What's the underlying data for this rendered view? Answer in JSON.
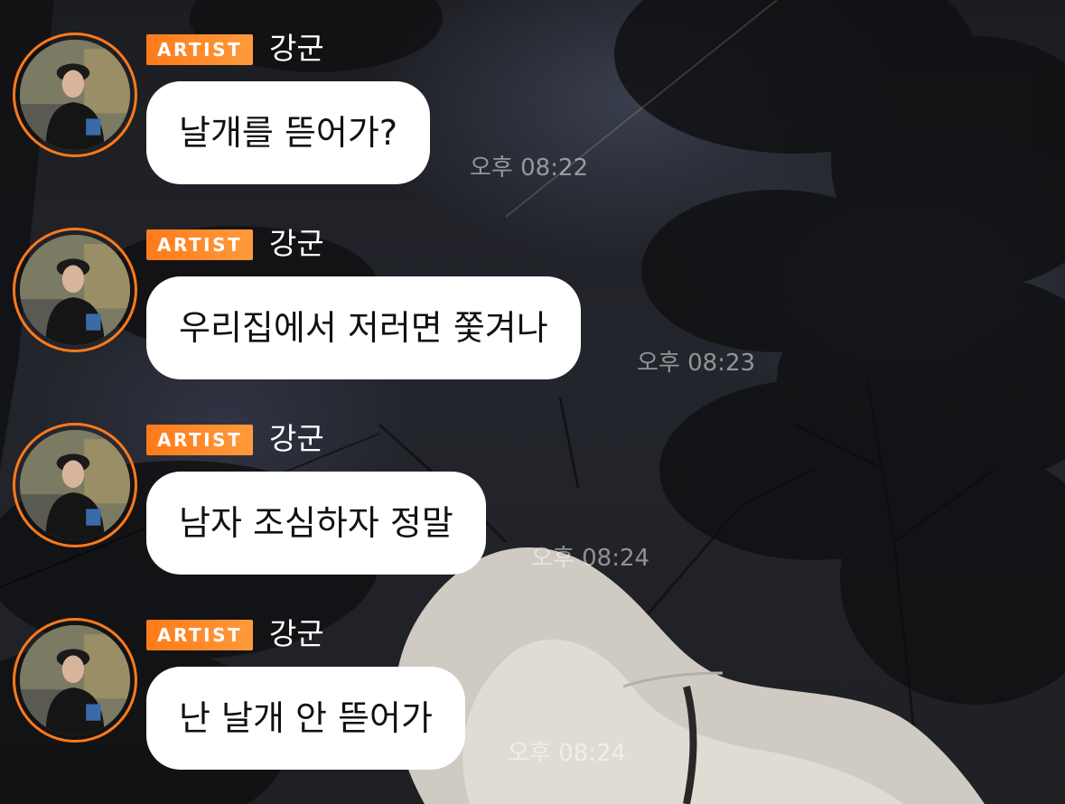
{
  "messages": [
    {
      "badge": "ARTIST",
      "sender": "강군",
      "text": "날개를 뜯어가?",
      "time": "오후 08:22"
    },
    {
      "badge": "ARTIST",
      "sender": "강군",
      "text": "우리집에서 저러면 쫓겨나",
      "time": "오후 08:23"
    },
    {
      "badge": "ARTIST",
      "sender": "강군",
      "text": "남자 조심하자 정말",
      "time": "오후 08:24"
    },
    {
      "badge": "ARTIST",
      "sender": "강군",
      "text": "난 날개 안 뜯어가",
      "time": "오후 08:24"
    }
  ],
  "colors": {
    "accent": "#ff7a1a",
    "bubble": "#ffffff",
    "timestamp": "rgba(255,255,255,0.5)"
  }
}
